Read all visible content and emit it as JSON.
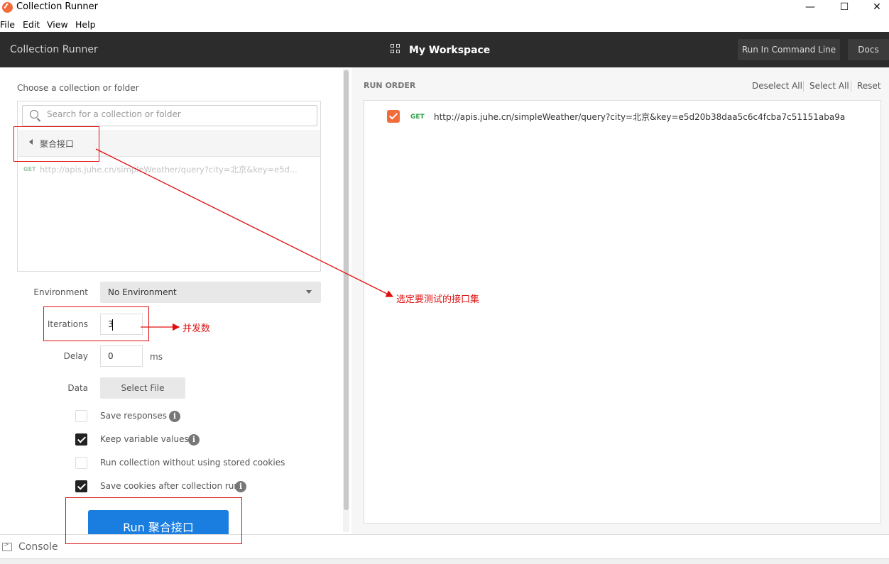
{
  "window": {
    "title": "Collection Runner",
    "minimize": "—",
    "maximize": "☐",
    "close": "✕"
  },
  "menu": [
    "File",
    "Edit",
    "View",
    "Help"
  ],
  "header": {
    "title": "Collection Runner",
    "workspace": "My Workspace",
    "chevron": "⌄",
    "run_cli": "Run In Command Line",
    "docs": "Docs"
  },
  "left": {
    "choose_label": "Choose a collection or folder",
    "search_placeholder": "Search for a collection or folder",
    "folder_name": "聚合接口",
    "request": {
      "method": "GET",
      "url": "http://apis.juhe.cn/simpleWeather/query?city=北京&key=e5d..."
    },
    "environment": {
      "label": "Environment",
      "value": "No Environment"
    },
    "iterations": {
      "label": "Iterations",
      "value": "3"
    },
    "delay": {
      "label": "Delay",
      "value": "0",
      "unit": "ms"
    },
    "data": {
      "label": "Data",
      "button": "Select File"
    },
    "options": [
      {
        "label": "Save responses",
        "checked": false,
        "info": true
      },
      {
        "label": "Keep variable values",
        "checked": true,
        "info": true
      },
      {
        "label": "Run collection without using stored cookies",
        "checked": false,
        "info": false
      },
      {
        "label": "Save cookies after collection run",
        "checked": true,
        "info": true
      }
    ],
    "info_glyph": "i",
    "run_button": "Run 聚合接口"
  },
  "right": {
    "run_order_label": "RUN ORDER",
    "deselect_all": "Deselect All",
    "select_all": "Select All",
    "reset": "Reset",
    "items": [
      {
        "method": "GET",
        "url": "http://apis.juhe.cn/simpleWeather/query?city=北京&key=e5d20b38daa5c6c4fcba7c51151aba9a",
        "checked": true
      }
    ]
  },
  "console": {
    "label": "Console"
  },
  "annotations": {
    "collection_note": "选定要测试的接口集",
    "iterations_note": "并发数",
    "color": "#e01010"
  },
  "colors": {
    "accent": "#f26b3a",
    "run_button": "#1a7de0",
    "header_bg": "#2c2c2c"
  }
}
